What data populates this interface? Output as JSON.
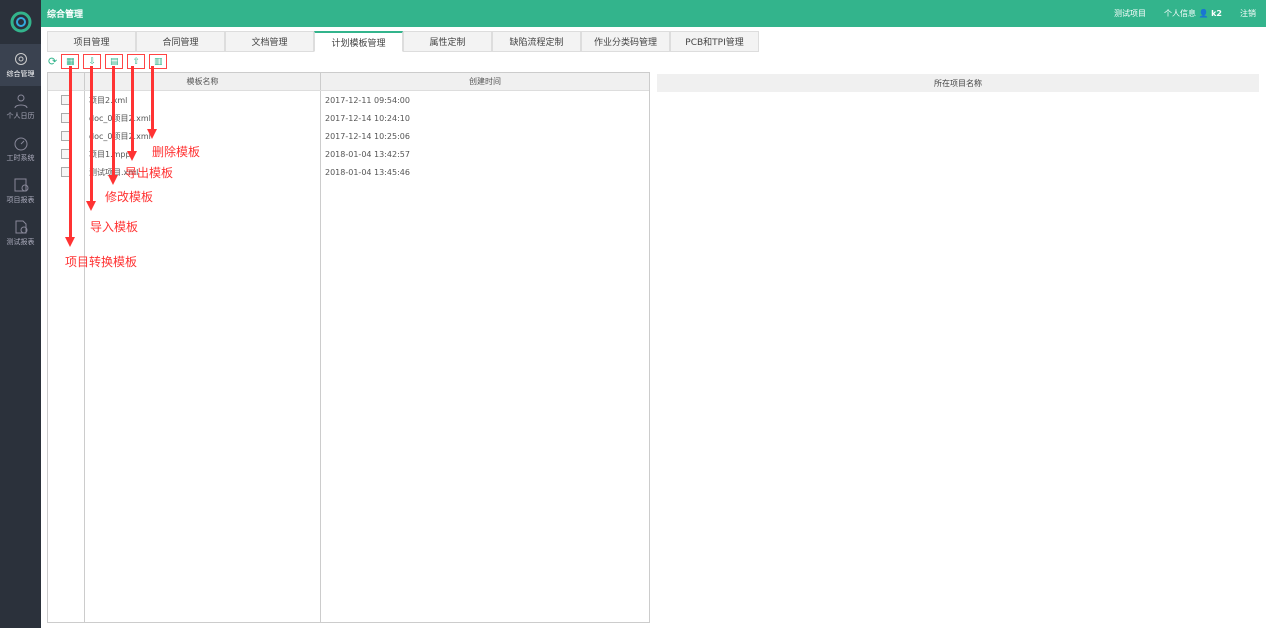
{
  "header": {
    "title": "综合管理",
    "project": "测试项目",
    "profile": "个人信息",
    "user": "k2",
    "logout": "注销"
  },
  "sidebar": {
    "items": [
      {
        "label": "综合管理"
      },
      {
        "label": "个人日历"
      },
      {
        "label": "工时系统"
      },
      {
        "label": "项目报表"
      },
      {
        "label": "测试报表"
      }
    ]
  },
  "tabs": [
    "项目管理",
    "合同管理",
    "文档管理",
    "计划模板管理",
    "属性定制",
    "缺陷流程定制",
    "作业分类码管理",
    "PCB和TPI管理"
  ],
  "grid": {
    "headers": [
      "模板名称",
      "创建时间"
    ],
    "rows": [
      {
        "name": "项目2.xml",
        "time": "2017-12-11 09:54:00"
      },
      {
        "name": "doc_0项目2.xml",
        "time": "2017-12-14 10:24:10"
      },
      {
        "name": "doc_0项目2.xml",
        "time": "2017-12-14 10:25:06"
      },
      {
        "name": "项目1.mpp",
        "time": "2018-01-04 13:42:57"
      },
      {
        "name": "测试项目.xml",
        "time": "2018-01-04 13:45:46"
      }
    ]
  },
  "right_panel": {
    "header": "所在项目名称"
  },
  "annotations": {
    "convert": "项目转换模板",
    "import": "导入模板",
    "edit": "修改模板",
    "export": "导出模板",
    "delete": "删除模板"
  }
}
